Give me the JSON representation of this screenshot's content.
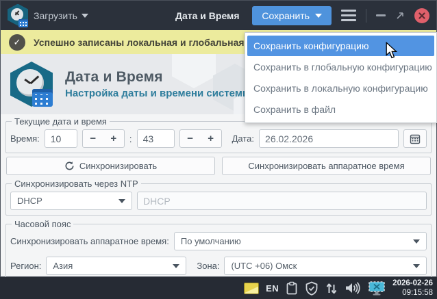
{
  "colors": {
    "accent": "#5294e2",
    "titlebar_bg": "#2b313b",
    "notification_bg": "#eceb9d",
    "close_button": "#e0606b"
  },
  "titlebar": {
    "load_label": "Загрузить",
    "title": "Дата и Время",
    "save_label": "Сохранить"
  },
  "notification": {
    "text": "Успешно записаны локальная и глобальная конф"
  },
  "save_menu": {
    "items": [
      {
        "label": "Сохранить конфигурацию",
        "active": true
      },
      {
        "label": "Сохранить в глобальную конфигурацию",
        "active": false
      },
      {
        "label": "Сохранить в локальную конфигурацию",
        "active": false
      },
      {
        "label": "Сохранить в файл",
        "active": false
      }
    ]
  },
  "banner": {
    "title": "Дата и Время",
    "subtitle": "Настройка даты и времени системы"
  },
  "form": {
    "current": {
      "legend": "Текущие дата и время",
      "time_label": "Время:",
      "hours": "10",
      "colon": ":",
      "minutes": "43",
      "minus": "−",
      "plus": "+",
      "date_label": "Дата:",
      "date_value": "26.02.2026"
    },
    "buttons": {
      "sync": "Синхронизировать",
      "sync_hw": "Синхронизировать аппаратное время"
    },
    "ntp": {
      "legend": "Синхронизировать через NTP",
      "mode": "DHCP",
      "server_placeholder": "DHCP"
    },
    "tz": {
      "legend": "Часовой пояс",
      "hw_label": "Синхронизировать аппаратное время:",
      "hw_value": "По умолчанию",
      "region_label": "Регион:",
      "region_value": "Азия",
      "zone_label": "Зона:",
      "zone_value": "(UTC +06) Омск"
    }
  },
  "taskbar": {
    "lang": "EN",
    "date": "2026-02-26",
    "time": "09:15:58"
  }
}
